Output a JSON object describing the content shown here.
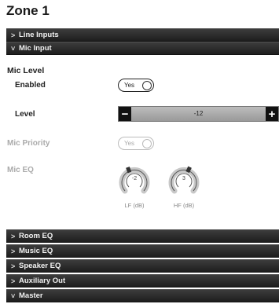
{
  "zone_title": "Zone 1",
  "sections_top": [
    {
      "chevron": ">",
      "label": "Line Inputs"
    },
    {
      "chevron": "˅",
      "label": "Mic Input"
    }
  ],
  "mic_level": {
    "heading": "Mic Level",
    "enabled_label": "Enabled",
    "enabled_value": "Yes",
    "level_label": "Level",
    "level_value": "-12",
    "minus": "−",
    "plus": "+"
  },
  "mic_priority": {
    "label": "Mic Priority",
    "value": "Yes"
  },
  "mic_eq": {
    "label": "Mic EQ",
    "lf_value": "-2",
    "lf_label": "LF (dB)",
    "hf_value": "3",
    "hf_label": "HF (dB)"
  },
  "sections_bottom": [
    {
      "chevron": ">",
      "label": "Room EQ"
    },
    {
      "chevron": ">",
      "label": "Music EQ"
    },
    {
      "chevron": ">",
      "label": "Speaker EQ"
    },
    {
      "chevron": ">",
      "label": "Auxiliary Out"
    },
    {
      "chevron": "˅",
      "label": "Master"
    }
  ]
}
